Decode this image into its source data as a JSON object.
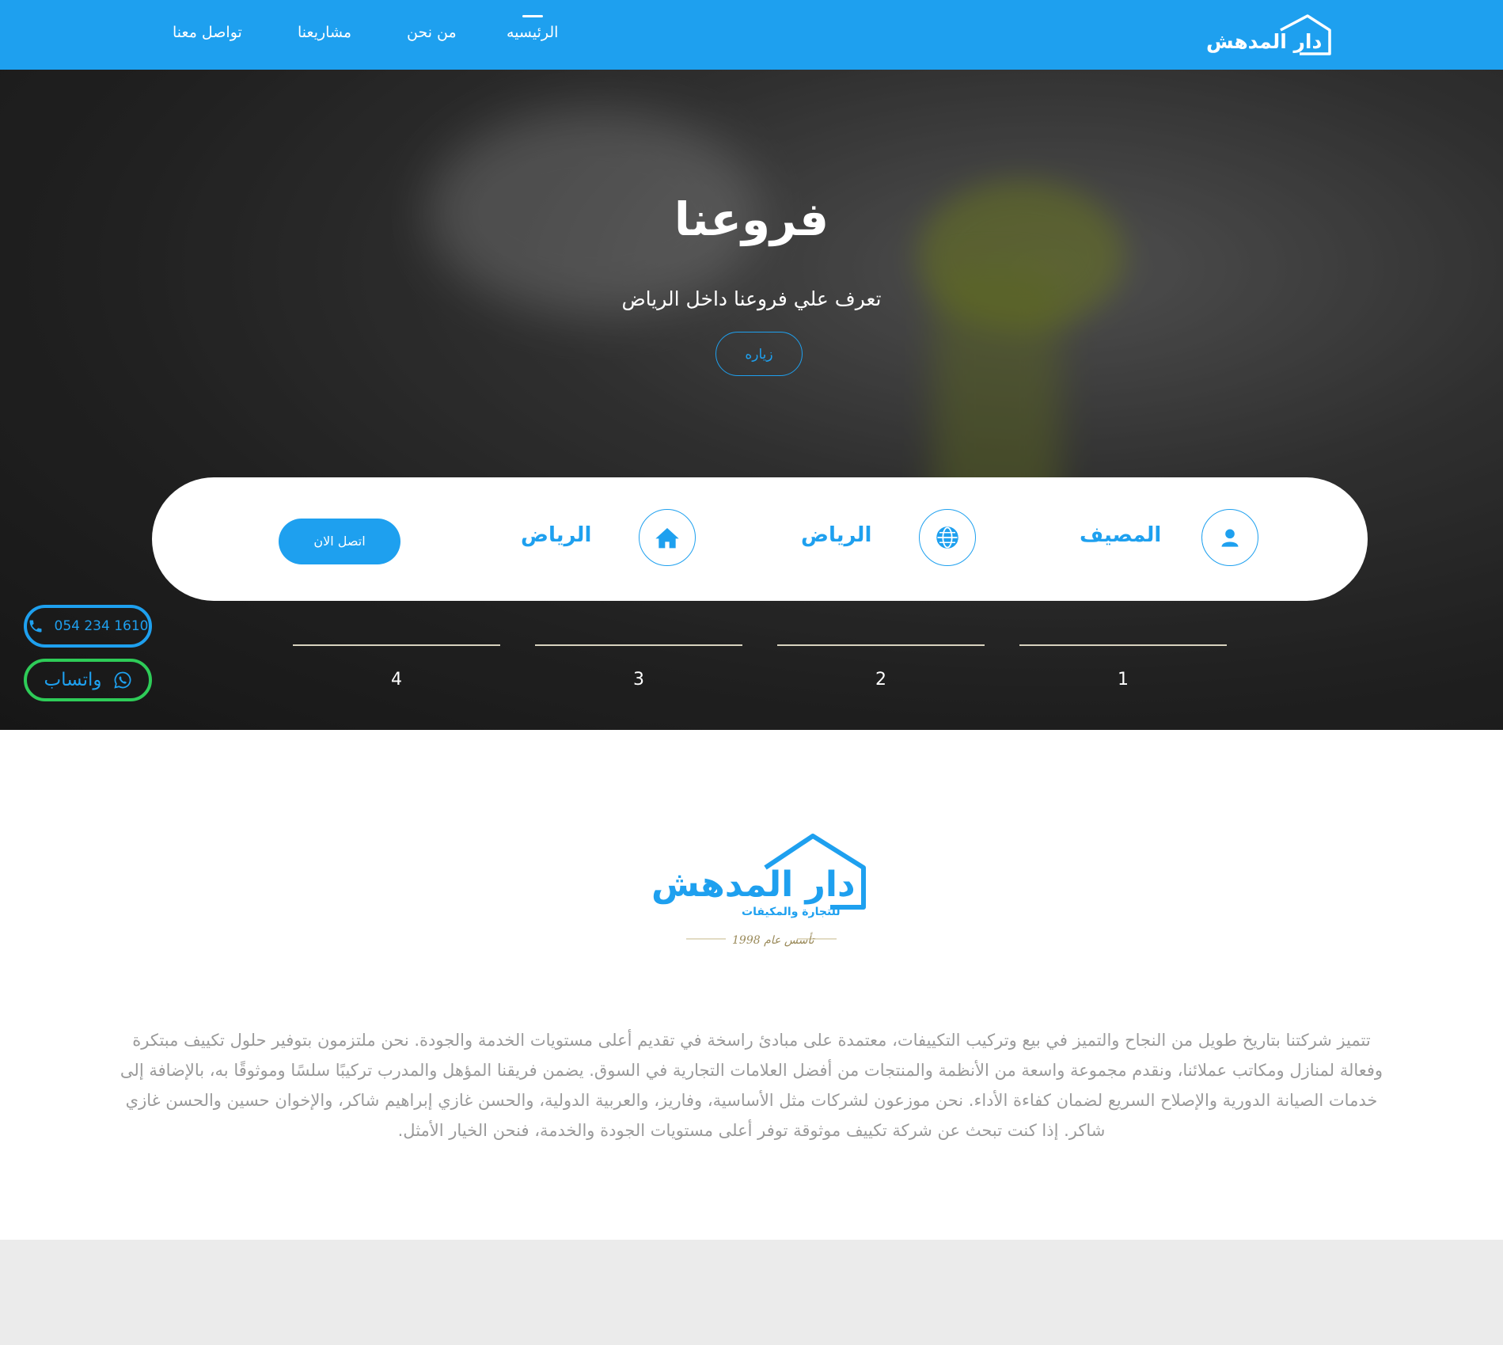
{
  "header": {
    "logo_text": "دار المدهش",
    "nav": [
      {
        "label": "الرئيسيه",
        "active": true
      },
      {
        "label": "من نحن",
        "active": false
      },
      {
        "label": "مشاريعنا",
        "active": false
      },
      {
        "label": "تواصل معنا",
        "active": false
      }
    ]
  },
  "hero": {
    "title": "فروعنا",
    "subtitle": "تعرف علي فروعنا داخل الرياض",
    "visit_button": "زياره"
  },
  "info_card": {
    "items": [
      {
        "icon": "user-icon",
        "label": "المصيف"
      },
      {
        "icon": "globe-icon",
        "label": "الرياض"
      },
      {
        "icon": "home-icon",
        "label": "الرياض"
      }
    ],
    "contact_button": "اتصل الان"
  },
  "steps": [
    "1",
    "2",
    "3",
    "4"
  ],
  "floating": {
    "phone": "054 234 1610",
    "whatsapp": "واتساب"
  },
  "about": {
    "logo_title": "دار المدهش",
    "logo_subtitle": "للتجارة والمكيفات",
    "logo_since": "تأسس عام 1998",
    "text": "تتميز شركتنا بتاريخ طويل من النجاح والتميز في بيع وتركيب التكييفات، معتمدة على مبادئ راسخة في تقديم أعلى مستويات الخدمة والجودة. نحن ملتزمون بتوفير حلول تكييف مبتكرة وفعالة لمنازل ومكاتب عملائنا، ونقدم مجموعة واسعة من الأنظمة والمنتجات من أفضل العلامات التجارية في السوق. يضمن فريقنا المؤهل والمدرب تركيبًا سلسًا وموثوقًا به، بالإضافة إلى خدمات الصيانة الدورية والإصلاح السريع لضمان كفاءة الأداء. نحن موزعون لشركات مثل الأساسية، وفاريز، والعربية الدولية، والحسن غازي إبراهيم شاكر، والإخوان حسين والحسن غازي شاكر. إذا كنت تبحث عن شركة تكييف موثوقة توفر أعلى مستويات الجودة والخدمة، فنحن الخيار الأمثل."
  },
  "colors": {
    "brand_blue": "#1ea0ef",
    "whatsapp_green": "#2ecc58",
    "text_gray": "#9a9a9a"
  }
}
